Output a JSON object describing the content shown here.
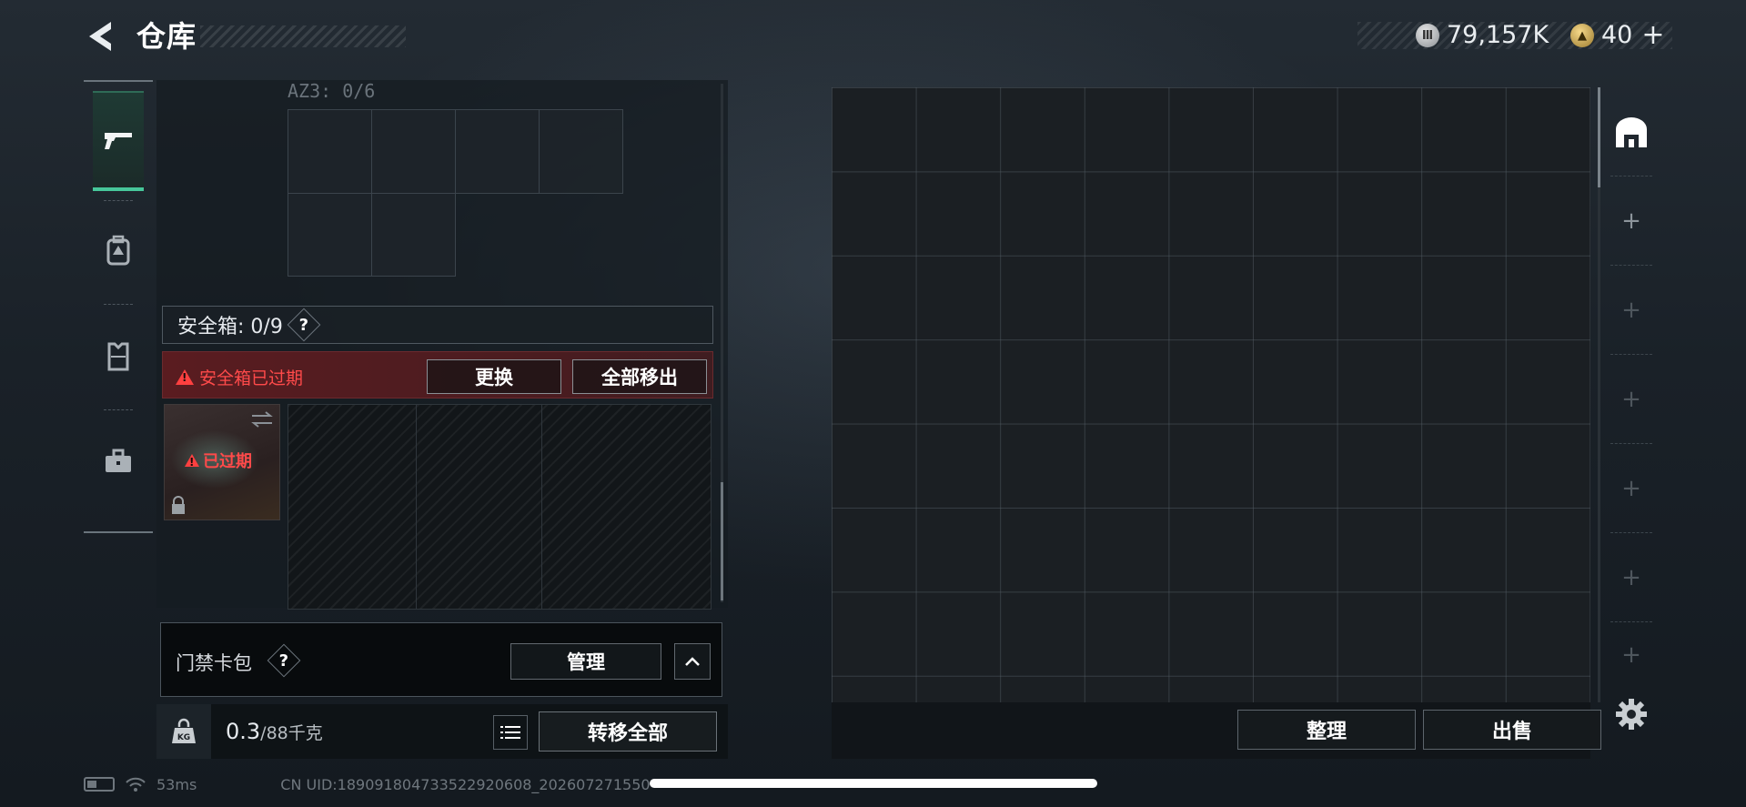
{
  "header": {
    "title": "仓库",
    "currency": [
      {
        "name": "silver-coin",
        "amount": "79,157K"
      },
      {
        "name": "gold-coin",
        "amount": "40"
      }
    ],
    "add_symbol": "+"
  },
  "rail": {
    "items": [
      {
        "icon": "pistol-icon",
        "active": true
      },
      {
        "icon": "backpack-icon",
        "active": false
      },
      {
        "icon": "vest-icon",
        "active": false
      },
      {
        "icon": "briefcase-icon",
        "active": false
      }
    ]
  },
  "container": {
    "cut_label": "AZ3: 0/6",
    "safe_box": {
      "label": "安全箱: 0/9",
      "help": "?",
      "expired_warning": "安全箱已过期",
      "replace_button": "更换",
      "remove_all_button": "全部移出",
      "item_status": "已过期"
    },
    "keycard": {
      "label": "门禁卡包",
      "help": "?",
      "manage_button": "管理"
    },
    "weight": {
      "current": "0.3",
      "max": "/88千克",
      "transfer_all_button": "转移全部"
    }
  },
  "stash": {
    "sort_button": "整理",
    "sell_button": "出售"
  },
  "side_tabs": [
    "+",
    "+",
    "+",
    "+",
    "+",
    "+"
  ],
  "footer": {
    "ping": "53ms",
    "uid": "CN UID:1890918047335229206​08_202607271550"
  },
  "colors": {
    "accent_green": "#47c79a",
    "warning_red": "#ff4a4a"
  }
}
